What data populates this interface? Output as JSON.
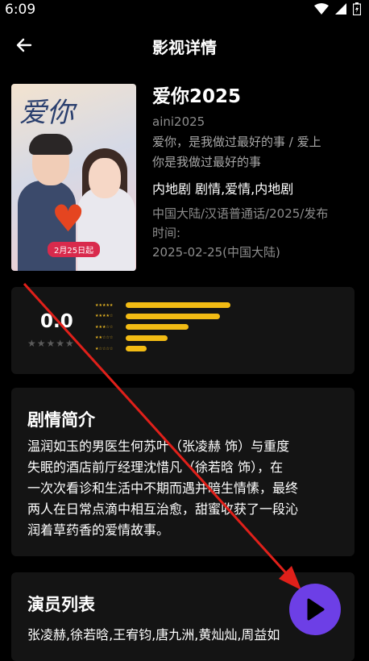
{
  "status_bar": {
    "time": "6:09"
  },
  "header": {
    "title": "影视详情"
  },
  "poster": {
    "title_art": "爱你",
    "date_badge": "2月25日起"
  },
  "movie": {
    "title": "爱你2025",
    "alias": "aini2025",
    "aliases_line1": "爱你，是我做过最好的事 / 爱上",
    "aliases_line2": "你是我做过最好的事",
    "genre": "内地剧 剧情,爱情,内地剧",
    "meta_line1": "中国大陆/汉语普通话/2025/发布",
    "meta_line2": "时间:",
    "meta_line3": "2025-02-25(中国大陆)"
  },
  "rating": {
    "score": "0.0",
    "score_stars": "★★★★★",
    "distribution": [
      {
        "stars": "★★★★★",
        "fraction": 1.0
      },
      {
        "stars": "★★★★☆",
        "fraction": 0.9
      },
      {
        "stars": "★★★☆☆",
        "fraction": 0.6
      },
      {
        "stars": "★★☆☆☆",
        "fraction": 0.4
      },
      {
        "stars": "★☆☆☆☆",
        "fraction": 0.2
      }
    ]
  },
  "synopsis": {
    "title": "剧情简介",
    "line1": "温润如玉的男医生何苏叶（张凌赫 饰）与重度",
    "line2": "失眠的酒店前厅经理沈惜凡（徐若晗 饰），在",
    "line3": "一次次看诊和生活中不期而遇并暗生情愫，最终",
    "line4": "两人在日常点滴中相互治愈，甜蜜收获了一段沁",
    "line5": "润着草药香的爱情故事。"
  },
  "cast": {
    "title": "演员列表",
    "names": "张凌赫,徐若晗,王宥钧,唐九洲,黄灿灿,周益如"
  },
  "colors": {
    "accent": "#f2bb14",
    "play": "#6d3fe6",
    "arrow": "#e0201a"
  },
  "icons": {
    "back": "arrow-left-icon",
    "play": "play-icon",
    "wifi": "wifi-icon",
    "signal": "signal-icon",
    "battery": "battery-icon"
  }
}
